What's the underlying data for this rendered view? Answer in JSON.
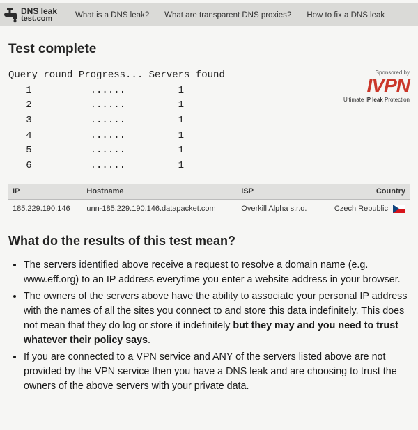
{
  "site": {
    "name_line1": "DNS leak",
    "name_line2": "test.com"
  },
  "nav": {
    "what_is": "What is a DNS leak?",
    "proxies": "What are transparent DNS proxies?",
    "fix": "How to fix a DNS leak"
  },
  "heading": "Test complete",
  "query": {
    "header_round": "Query round",
    "header_progress": "Progress...",
    "header_servers": "Servers found",
    "rows": [
      {
        "round": "1",
        "progress": "......",
        "servers": "1"
      },
      {
        "round": "2",
        "progress": "......",
        "servers": "1"
      },
      {
        "round": "3",
        "progress": "......",
        "servers": "1"
      },
      {
        "round": "4",
        "progress": "......",
        "servers": "1"
      },
      {
        "round": "5",
        "progress": "......",
        "servers": "1"
      },
      {
        "round": "6",
        "progress": "......",
        "servers": "1"
      }
    ]
  },
  "sponsor": {
    "label": "Sponsored by",
    "brand": "IVPN",
    "tagline_prefix": "Ultimate ",
    "tagline_bold": "IP leak",
    "tagline_suffix": " Protection"
  },
  "results": {
    "headers": {
      "ip": "IP",
      "hostname": "Hostname",
      "isp": "ISP",
      "country": "Country"
    },
    "rows": [
      {
        "ip": "185.229.190.146",
        "hostname": "unn-185.229.190.146.datapacket.com",
        "isp": "Overkill Alpha s.r.o.",
        "country": "Czech Republic"
      }
    ]
  },
  "explain": {
    "heading": "What do the results of this test mean?",
    "p1": "The servers identified above receive a request to resolve a domain name (e.g. www.eff.org) to an IP address everytime you enter a website address in your browser.",
    "p2a": "The owners of the servers above have the ability to associate your personal IP address with the names of all the sites you connect to and store this data indefinitely. This does not mean that they do log or store it indefinitely ",
    "p2b": "but they may and you need to trust whatever their policy says",
    "p2c": ".",
    "p3": "If you are connected to a VPN service and ANY of the servers listed above are not provided by the VPN service then you have a DNS leak and are choosing to trust the owners of the above servers with your private data."
  }
}
